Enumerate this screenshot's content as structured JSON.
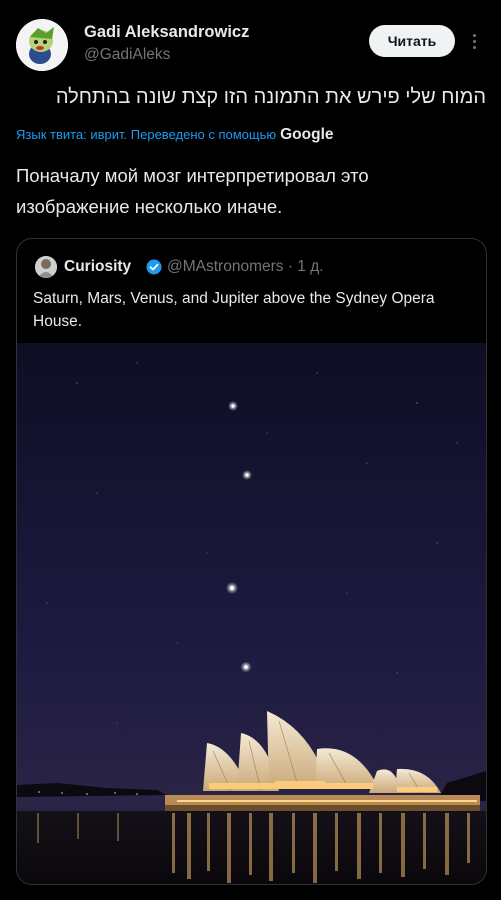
{
  "author": {
    "display_name": "Gadi Aleksandrowicz",
    "handle": "@GadiAleks"
  },
  "follow_button_label": "Читать",
  "more_icon": "more-vertical-icon",
  "tweet": {
    "original_text": "המוח שלי פירש את התמונה הזו קצת שונה בהתחלה",
    "translation_note": "Язык твита: иврит. Переведено с помощью",
    "translation_provider": "Google",
    "translated_text": "Поначалу мой мозг интерпретировал это изображение несколько иначе."
  },
  "quoted_tweet": {
    "display_name": "Curiosity",
    "verified_icon": "verified-badge-icon",
    "handle_time": "@MAstronomers · 1 д.",
    "text": "Saturn, Mars, Venus, and Jupiter above the Sydney Opera House.",
    "image_alt": "night-sky-opera-house-photo"
  },
  "colors": {
    "background": "#000000",
    "text_primary": "#e7e9ea",
    "text_secondary": "#71767b",
    "link_blue": "#1d9bf0",
    "border": "#2f3336"
  }
}
